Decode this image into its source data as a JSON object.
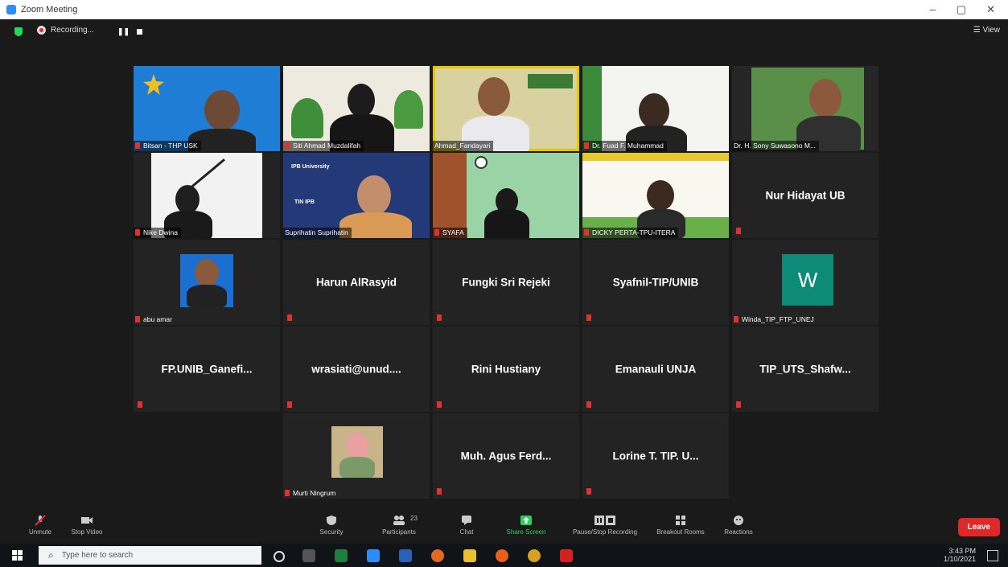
{
  "window": {
    "title": "Zoom Meeting",
    "controls": [
      "–",
      "▢",
      "✕"
    ]
  },
  "topbar": {
    "recording_label": "Recording...",
    "pause_label": "❚❚",
    "view_label": "☰ View"
  },
  "video_tiles": [
    "Bitsan - THP USK",
    "Siti Ahmad Muzdalifah",
    "Ahmad_Fandayari",
    "Dr. Fuad F. Muhammad",
    "Dr. H. Sony Suwasono M...",
    "Nike Dwina",
    "Suprihatin Suprihatin",
    "SYAFA",
    "DICKY PERTA-TPU-ITERA"
  ],
  "logo_tile": {
    "line1": "IPB University",
    "line2": "TIN IPB"
  },
  "name_tiles": [
    "Nur Hidayat UB",
    "Harun AlRasyid",
    "Fungki Sri Rejeki",
    "Syafnil-TIP/UNIB",
    "FP.UNIB_Ganefi...",
    "wrasiati@unud....",
    "Rini Hustiany",
    "Emanauli UNJA",
    "TIP_UTS_Shafw...",
    "Muh. Agus Ferd...",
    "Lorine T. TIP. U..."
  ],
  "photo_tiles": {
    "abu_label": "abu amar",
    "murti_label": "Murti Ningrum",
    "winda_label": "Winda_TIP_FTP_UNEJ",
    "winda_letter": "W"
  },
  "toolbar": {
    "unmute": "Unmute",
    "stop_video": "Stop Video",
    "security": "Security",
    "participants": "Participants",
    "participant_count": "23",
    "chat": "Chat",
    "share_screen": "Share Screen",
    "pause_recording": "Pause/Stop Recording",
    "breakout": "Breakout Rooms",
    "reactions": "Reactions",
    "leave": "Leave"
  },
  "taskbar": {
    "search_placeholder": "Type here to search",
    "time": "3:43 PM",
    "date": "1/10/2021"
  },
  "colors": {
    "active_speaker": "#e5c400",
    "leave": "#e02828",
    "share": "#2bd05a"
  }
}
